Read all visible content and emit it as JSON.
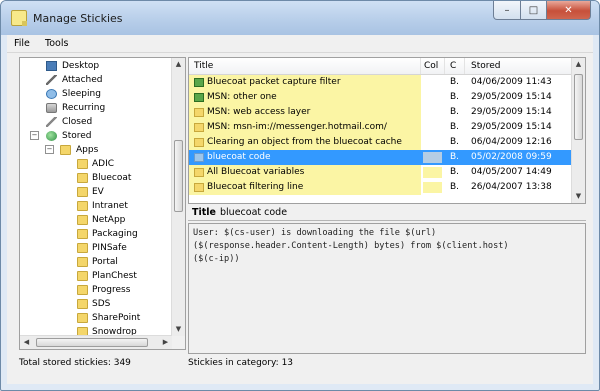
{
  "window": {
    "title": "Manage Stickies",
    "btn_min": "–",
    "btn_max": "□",
    "btn_close": "✕"
  },
  "menu": {
    "file": "File",
    "tools": "Tools"
  },
  "tree": {
    "items": [
      {
        "label": "Desktop",
        "icon": "desktop-icon"
      },
      {
        "label": "Attached",
        "icon": "pen-icon"
      },
      {
        "label": "Sleeping",
        "icon": "clock-icon"
      },
      {
        "label": "Recurring",
        "icon": "recurring-icon"
      },
      {
        "label": "Closed",
        "icon": "pin-icon"
      },
      {
        "label": "Stored",
        "icon": "globe-icon"
      },
      {
        "label": "Apps",
        "icon": "folder-icon"
      },
      {
        "label": "ADIC",
        "icon": "folder-icon"
      },
      {
        "label": "Bluecoat",
        "icon": "folder-icon"
      },
      {
        "label": "EV",
        "icon": "folder-icon"
      },
      {
        "label": "Intranet",
        "icon": "folder-icon"
      },
      {
        "label": "NetApp",
        "icon": "folder-icon"
      },
      {
        "label": "Packaging",
        "icon": "folder-icon"
      },
      {
        "label": "PINSafe",
        "icon": "folder-icon"
      },
      {
        "label": "Portal",
        "icon": "folder-icon"
      },
      {
        "label": "PlanChest",
        "icon": "folder-icon"
      },
      {
        "label": "Progress",
        "icon": "folder-icon"
      },
      {
        "label": "SDS",
        "icon": "folder-icon"
      },
      {
        "label": "SharePoint",
        "icon": "folder-icon"
      },
      {
        "label": "Snowdrop",
        "icon": "folder-icon"
      }
    ],
    "expand_stored": "−",
    "expand_apps": "−"
  },
  "list": {
    "headers": {
      "title": "Title",
      "col": "Col",
      "c": "C",
      "stored": "Stored"
    },
    "rows": [
      {
        "title": "Bluecoat packet capture filter",
        "c": "B.",
        "stored": "04/06/2009 11:43",
        "icon": "green"
      },
      {
        "title": "MSN: other one",
        "c": "B.",
        "stored": "29/05/2009 15:14",
        "icon": "green"
      },
      {
        "title": "MSN: web access layer",
        "c": "B.",
        "stored": "29/05/2009 15:14",
        "icon": "plain"
      },
      {
        "title": "MSN: msn-im://messenger.hotmail.com/",
        "c": "B.",
        "stored": "29/05/2009 15:14",
        "icon": "plain"
      },
      {
        "title": "Clearing an object from the bluecoat cache",
        "c": "B.",
        "stored": "06/04/2009 12:16",
        "icon": "plain"
      },
      {
        "title": "bluecoat code",
        "c": "B.",
        "stored": "05/02/2008 09:59",
        "icon": "plain",
        "selected": true
      },
      {
        "title": "All Bluecoat variables",
        "c": "B.",
        "stored": "04/05/2007 14:49",
        "icon": "plain"
      },
      {
        "title": "Bluecoat filtering line",
        "c": "B.",
        "stored": "26/04/2007 13:38",
        "icon": "plain"
      }
    ]
  },
  "detail": {
    "title_label": "Title",
    "title_value": "bluecoat code",
    "body": "User: $(cs-user) is downloading the file $(url)\n($(response.header.Content-Length) bytes) from $(client.host)\n($(c-ip))"
  },
  "status": {
    "total": "Total stored stickies: 349",
    "category": "Stickies in category: 13"
  },
  "colors": {
    "sticky_yellow": "#fbf5a4",
    "selection_blue": "#3399ff",
    "selected_row_col": "#b4cde4"
  }
}
